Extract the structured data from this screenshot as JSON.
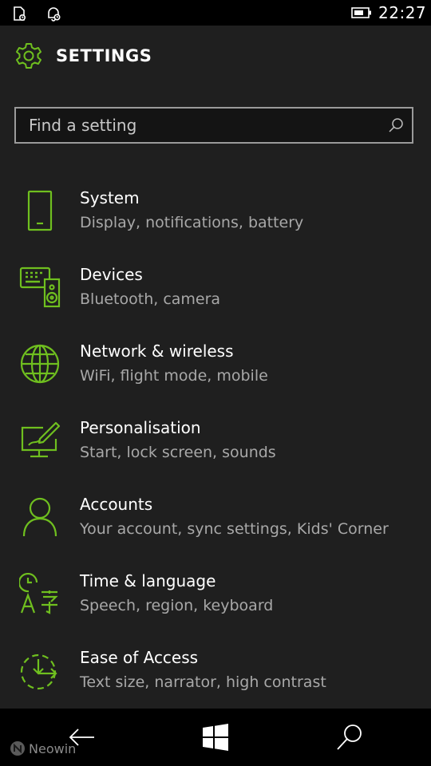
{
  "status_bar": {
    "time": "22:27",
    "icons": [
      "notification-icon",
      "quiet-hours-icon",
      "battery-icon"
    ]
  },
  "header": {
    "title": "SETTINGS",
    "icon": "gear-icon"
  },
  "search": {
    "placeholder": "Find a setting",
    "value": "",
    "icon": "search-icon"
  },
  "categories": [
    {
      "title": "System",
      "subtitle": "Display, notifications, battery",
      "icon": "phone-icon"
    },
    {
      "title": "Devices",
      "subtitle": "Bluetooth, camera",
      "icon": "devices-icon"
    },
    {
      "title": "Network & wireless",
      "subtitle": "WiFi, flight mode, mobile",
      "icon": "globe-icon"
    },
    {
      "title": "Personalisation",
      "subtitle": "Start, lock screen, sounds",
      "icon": "personalise-icon"
    },
    {
      "title": "Accounts",
      "subtitle": "Your account, sync settings, Kids' Corner",
      "icon": "person-icon"
    },
    {
      "title": "Time & language",
      "subtitle": "Speech, region, keyboard",
      "icon": "time-language-icon"
    },
    {
      "title": "Ease of Access",
      "subtitle": "Text size, narrator, high contrast",
      "icon": "ease-of-access-icon"
    }
  ],
  "nav_bar": {
    "buttons": [
      "back-icon",
      "windows-icon",
      "search-icon"
    ],
    "watermark": "Neowin"
  },
  "colors": {
    "accent": "#6fbf1f",
    "background": "#1f1f1f",
    "text": "#ffffff",
    "subtext": "#a8a8a8"
  }
}
